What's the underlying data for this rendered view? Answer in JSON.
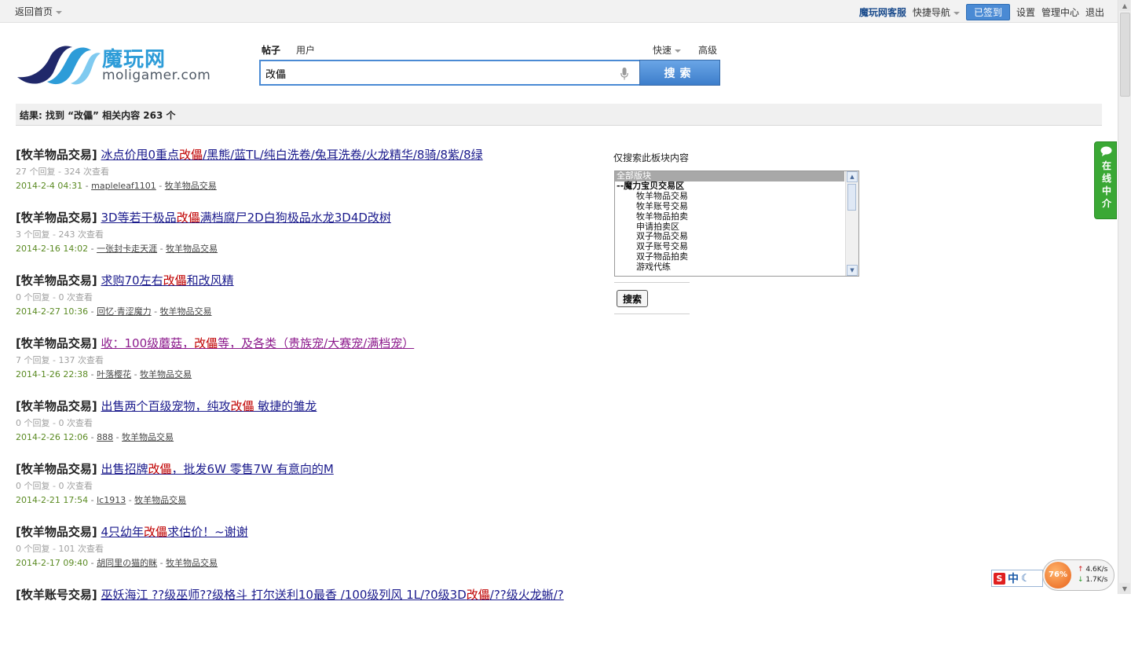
{
  "topbar": {
    "back_label": "返回首页",
    "service_label": "魔玩网客服",
    "quick_nav_label": "快捷导航",
    "checkin_label": "已签到",
    "settings_label": "设置",
    "admin_label": "管理中心",
    "logout_label": "退出"
  },
  "logo": {
    "name_cn": "魔玩网",
    "domain": "moligamer.com"
  },
  "search": {
    "tab_posts": "帖子",
    "tab_users": "用户",
    "quick_label": "快速",
    "advanced_label": "高级",
    "query": "改儡",
    "button_label": "搜索"
  },
  "result_summary": "结果: 找到 “改儡” 相关内容 263 个",
  "results": [
    {
      "category": "[牧羊物品交易]",
      "title_before": "冰点价甩0重点",
      "title_highlight": "改儡",
      "title_after": "/黑熊/蓝TL/纯白洗卷/兔耳洗卷/火龙精华/8骑/8紫/8绿",
      "stats": "27 个回复 - 324 次查看",
      "date": "2014-2-4 04:31",
      "user": "mapleleaf1101",
      "forum": "牧羊物品交易"
    },
    {
      "category": "[牧羊物品交易]",
      "title_before": "3D等若干极品",
      "title_highlight": "改儡",
      "title_after": "满档腐尸2D白狗极品水龙3D4D改树",
      "stats": "3 个回复 - 243 次查看",
      "date": "2014-2-16 14:02",
      "user": "一张封卡走天涯",
      "forum": "牧羊物品交易"
    },
    {
      "category": "[牧羊物品交易]",
      "title_before": "求购70左右",
      "title_highlight": "改儡",
      "title_after": "和改风精",
      "stats": "0 个回复 - 0 次查看",
      "date": "2014-2-27 10:36",
      "user": "回忆·青涩魔力",
      "forum": "牧羊物品交易"
    },
    {
      "category": "[牧羊物品交易]",
      "title_before": "收：100级蘑菇，",
      "title_highlight": "改儡",
      "title_after": "等，及各类（贵族宠/大赛宠/满档宠）",
      "stats": "7 个回复 - 137 次查看",
      "date": "2014-1-26 22:38",
      "user": "叶落樱花",
      "forum": "牧羊物品交易"
    },
    {
      "category": "[牧羊物品交易]",
      "title_before": "出售两个百级宠物，纯攻",
      "title_highlight": "改儡",
      "title_after": " 敏捷的雏龙",
      "stats": "0 个回复 - 0 次查看",
      "date": "2014-2-26 12:06",
      "user": "888",
      "forum": "牧羊物品交易"
    },
    {
      "category": "[牧羊物品交易]",
      "title_before": "出售招牌",
      "title_highlight": "改儡",
      "title_after": "，批发6W 零售7W 有意向的M",
      "stats": "0 个回复 - 0 次查看",
      "date": "2014-2-21 17:54",
      "user": "lc1913",
      "forum": "牧羊物品交易"
    },
    {
      "category": "[牧羊物品交易]",
      "title_before": "4只幼年",
      "title_highlight": "改儡",
      "title_after": "求估价！~谢谢",
      "stats": "0 个回复 - 101 次查看",
      "date": "2014-2-17 09:40",
      "user": "胡同里の猫的眯",
      "forum": "牧羊物品交易"
    },
    {
      "category": "[牧羊账号交易]",
      "title_before": "巫妖海江 ??级巫师??级格斗 打尔送利10最香 /100级列风 1L/?0级3D",
      "title_highlight": "改儡",
      "title_after": "/??级火龙蜥/?",
      "stats": "",
      "date": "",
      "user": "",
      "forum": ""
    }
  ],
  "filter": {
    "label": "仅搜索此板块内容",
    "options": [
      {
        "label": "全部版块",
        "kind": "sel"
      },
      {
        "label": "--魔力宝贝交易区",
        "kind": "grp"
      },
      {
        "label": "牧羊物品交易",
        "kind": "sub"
      },
      {
        "label": "牧羊账号交易",
        "kind": "sub"
      },
      {
        "label": "牧羊物品拍卖",
        "kind": "sub"
      },
      {
        "label": "申请拍卖区",
        "kind": "sub"
      },
      {
        "label": "双子物品交易",
        "kind": "sub"
      },
      {
        "label": "双子账号交易",
        "kind": "sub"
      },
      {
        "label": "双子物品拍卖",
        "kind": "sub"
      },
      {
        "label": "游戏代练",
        "kind": "sub"
      }
    ],
    "button_label": "搜索"
  },
  "chat_tab": {
    "label": "在线中介"
  },
  "tray": {
    "ime_label": "中",
    "cpu_percent": "76%",
    "upload_rate": "4.6K/s",
    "download_rate": "1.7K/s"
  }
}
